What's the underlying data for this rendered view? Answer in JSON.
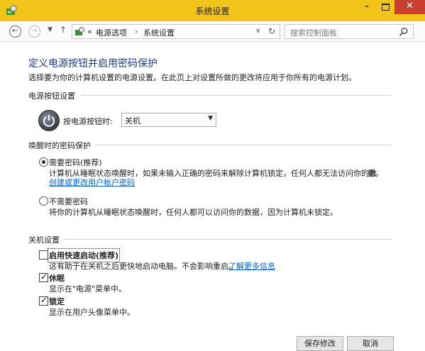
{
  "window": {
    "title": "系统设置"
  },
  "colors": {
    "titlebar": "#f0c419",
    "close": "#c7402d",
    "link": "#0066cc",
    "heading": "#1e3a8f"
  },
  "nav": {
    "back_icon": "arrow-left-icon",
    "forward_icon": "arrow-right-icon",
    "history_icon": "chevron-down-icon",
    "up_icon": "arrow-up-icon",
    "overflow": "«",
    "breadcrumb": [
      "电源选项",
      "系统设置"
    ],
    "separator": "›",
    "search_placeholder": "搜索控制面板"
  },
  "page": {
    "title": "定义电源按钮并启用密码保护",
    "subtitle": "选择要为你的计算机设置的电源设置。在此页上对设置所做的更改将应用于你所有的电源计划。"
  },
  "power_button": {
    "section": "电源按钮设置",
    "label": "按电源按钮时:",
    "selected": "关机"
  },
  "wake_password": {
    "section": "唤醒时的密码保护",
    "options": [
      {
        "label": "需要密码(推荐)",
        "desc": "计算机从睡眠状态唤醒时，如果未输入正确的密码来解除计算机锁定，任何人都无法访问你的数",
        "desc2": "据。",
        "link": "创建或更改用户帐户密码",
        "selected": true
      },
      {
        "label": "不需要密码",
        "desc": "将你的计算机从睡眠状态唤醒时，任何人都可以访问你的数据，因为计算机未锁定。",
        "selected": false
      }
    ]
  },
  "shutdown": {
    "section": "关机设置",
    "items": [
      {
        "label": "启用快速启动(推荐)",
        "desc": "这有助于在关机之后更快地启动电脑。不会影响重启。",
        "link": "了解更多信息",
        "checked": false
      },
      {
        "label": "休眠",
        "desc": "显示在\"电源\"菜单中。",
        "checked": true
      },
      {
        "label": "锁定",
        "desc": "显示在用户头像菜单中。",
        "checked": true
      }
    ]
  },
  "footer": {
    "save": "保存修改",
    "cancel": "取消"
  }
}
